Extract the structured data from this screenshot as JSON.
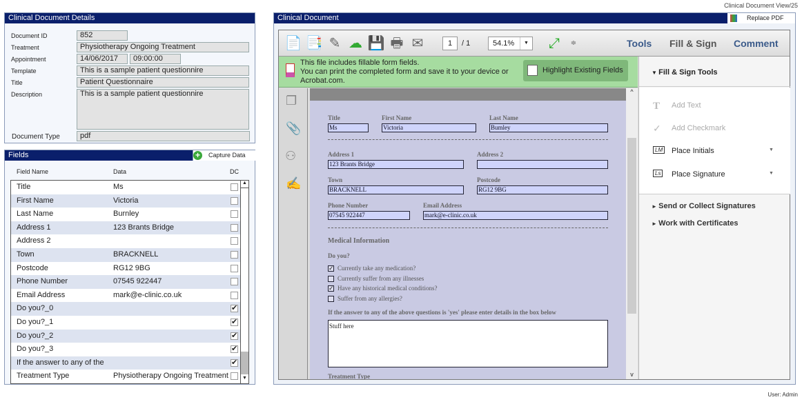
{
  "page_caption": "Clinical Document View/25",
  "user_label": "User: Admin",
  "details": {
    "title": "Clinical Document Details",
    "document_id_label": "Document ID",
    "document_id": "852",
    "treatment_label": "Treatment",
    "treatment": "Physiotherapy Ongoing Treatment",
    "appointment_label": "Appointment",
    "appointment_date": "14/06/2017",
    "appointment_time": "09:00:00",
    "template_label": "Template",
    "template": "This is a sample patient questionnire",
    "title_label": "Title",
    "title_value": "Patient Questionnaire",
    "description_label": "Description",
    "description": "This is a sample patient questionnire",
    "doctype_label": "Document Type",
    "doctype": "pdf"
  },
  "fields": {
    "title": "Fields",
    "capture_label": "Capture Data",
    "headers": {
      "name": "Field Name",
      "data": "Data",
      "dc": "DC"
    },
    "rows": [
      {
        "name": "Title",
        "data": "Ms",
        "dc": false
      },
      {
        "name": "First Name",
        "data": "Victoria",
        "dc": false
      },
      {
        "name": "Last Name",
        "data": "Burnley",
        "dc": false
      },
      {
        "name": "Address 1",
        "data": "123 Brants Bridge",
        "dc": false
      },
      {
        "name": "Address 2",
        "data": "",
        "dc": false
      },
      {
        "name": "Town",
        "data": "BRACKNELL",
        "dc": false
      },
      {
        "name": "Postcode",
        "data": "RG12 9BG",
        "dc": false
      },
      {
        "name": "Phone Number",
        "data": "07545 922447",
        "dc": false
      },
      {
        "name": "Email Address",
        "data": "mark@e-clinic.co.uk",
        "dc": false
      },
      {
        "name": "Do you?_0",
        "data": "",
        "dc": true
      },
      {
        "name": "Do you?_1",
        "data": "",
        "dc": true
      },
      {
        "name": "Do you?_2",
        "data": "",
        "dc": true
      },
      {
        "name": "Do you?_3",
        "data": "",
        "dc": true
      },
      {
        "name": "If the answer to any of the",
        "data": "",
        "dc": true
      },
      {
        "name": "Treatment Type",
        "data": "Physiotherapy Ongoing Treatment",
        "dc": false
      }
    ]
  },
  "document": {
    "title": "Clinical Document",
    "replace_label": "Replace PDF",
    "toolbar": {
      "page": "1",
      "page_total": "/ 1",
      "zoom": "54.1%",
      "tools": "Tools",
      "fill_sign": "Fill & Sign",
      "comment": "Comment"
    },
    "notice": {
      "line1": "This file includes fillable form fields.",
      "line2": "You can print the completed form and save it to your device or",
      "line3": "Acrobat.com.",
      "highlight": "Highlight Existing Fields"
    },
    "pane": {
      "section": "Fill & Sign Tools",
      "add_text": "Add Text",
      "add_check": "Add Checkmark",
      "initials": "Place Initials",
      "signature": "Place Signature",
      "send": "Send or Collect Signatures",
      "certs": "Work with Certificates"
    },
    "form": {
      "title_l": "Title",
      "title_v": "Ms",
      "first_l": "First Name",
      "first_v": "Victoria",
      "last_l": "Last Name",
      "last_v": "Bumley",
      "addr1_l": "Address 1",
      "addr1_v": "123 Brants Bridge",
      "addr2_l": "Address 2",
      "addr2_v": "",
      "town_l": "Town",
      "town_v": "BRACKNELL",
      "post_l": "Postcode",
      "post_v": "RG12 9BG",
      "phone_l": "Phone Number",
      "phone_v": "07545 922447",
      "email_l": "Email Address",
      "email_v": "mark@e-clinic.co.uk",
      "medical": "Medical Information",
      "doyou": "Do you?",
      "checks": [
        {
          "label": "Currently take any medication?",
          "checked": true
        },
        {
          "label": "Currently suffer from any illnesses",
          "checked": false
        },
        {
          "label": "Have any historical medical conditions?",
          "checked": true
        },
        {
          "label": "Suffer from any allergies?",
          "checked": false
        }
      ],
      "details_q": "If the answer to any of the above questions is 'yes' please enter details in the box below",
      "details_v": "Stuff here",
      "treatment_type": "Treatment Type"
    }
  }
}
